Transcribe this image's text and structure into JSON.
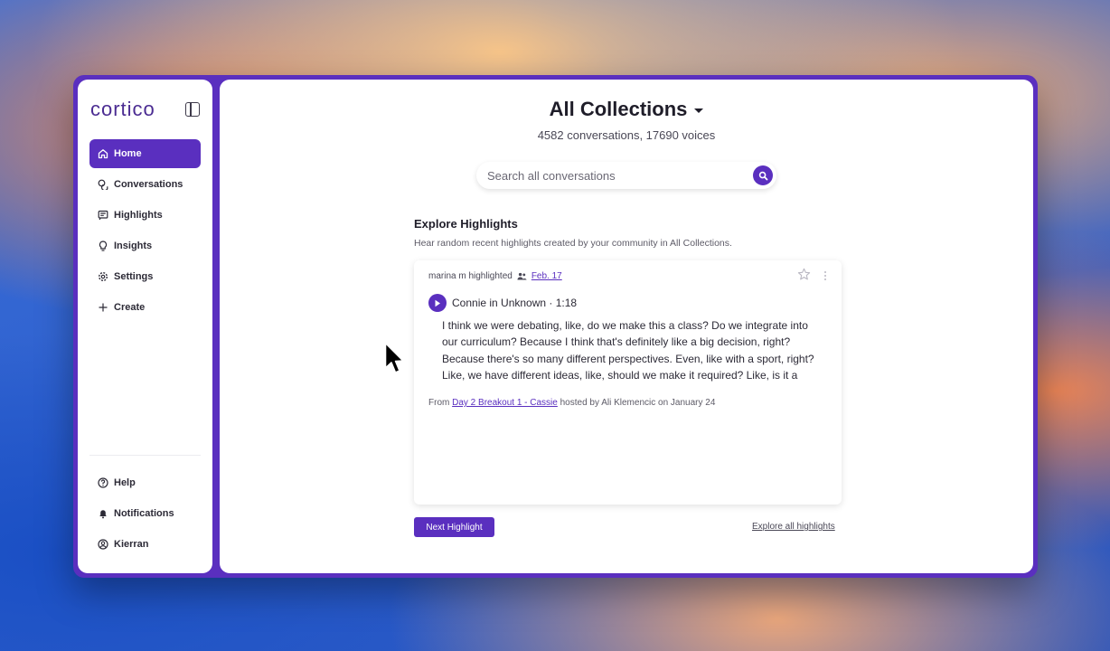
{
  "app": {
    "logo": "cortico"
  },
  "sidebar": {
    "items": [
      {
        "label": "Home",
        "icon": "home-icon",
        "active": true
      },
      {
        "label": "Conversations",
        "icon": "chat-bubbles-icon"
      },
      {
        "label": "Highlights",
        "icon": "highlight-icon"
      },
      {
        "label": "Insights",
        "icon": "lightbulb-icon"
      },
      {
        "label": "Settings",
        "icon": "gear-icon"
      },
      {
        "label": "Create",
        "icon": "plus-icon"
      }
    ],
    "bottom_items": [
      {
        "label": "Help",
        "icon": "help-icon"
      },
      {
        "label": "Notifications",
        "icon": "bell-icon"
      },
      {
        "label": "Kierran",
        "icon": "user-icon"
      }
    ]
  },
  "header": {
    "title": "All Collections",
    "subtitle": "4582 conversations, 17690 voices"
  },
  "search": {
    "placeholder": "Search all conversations"
  },
  "explore": {
    "title": "Explore Highlights",
    "subtitle": "Hear random recent highlights created by your community in All Collections."
  },
  "highlight": {
    "author": "marina m highlighted",
    "date": "Feb. 17",
    "speaker": "Connie in Unknown · 1:18",
    "quote_lines": [
      "I think we were debating, like, do we make this a class? Do we integrate into",
      "our curriculum? Because I think that's definitely like a big decision, right?",
      "Because there's so many different perspectives. Even, like with a sport, right?",
      "Like, we have different ideas, like, should we make it required? Like, is it a"
    ],
    "from_prefix": "From",
    "from_link": "Day 2 Breakout 1 - Cassie",
    "from_suffix": "hosted by Ali Klemencic on January 24"
  },
  "actions": {
    "next_label": "Next Highlight",
    "explore_all_label": "Explore all highlights"
  },
  "colors": {
    "accent": "#5a2fbf"
  }
}
